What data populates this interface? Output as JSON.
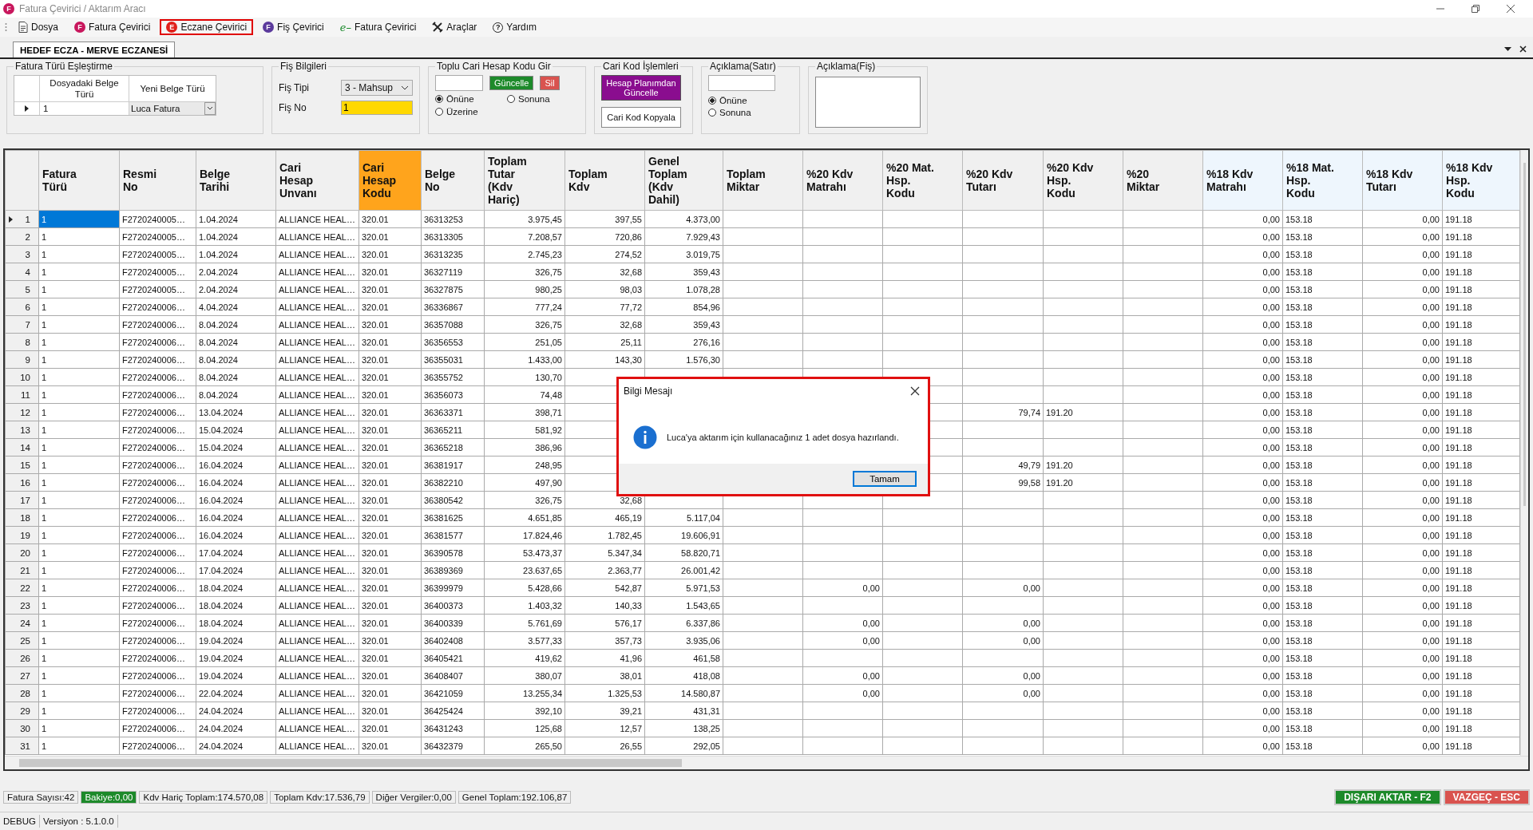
{
  "window": {
    "title": "Fatura Çevirici / Aktarım Aracı",
    "badge": "F"
  },
  "menu": [
    {
      "label": "Dosya",
      "kind": "document",
      "selected": false
    },
    {
      "label": "Fatura Çevirici",
      "kind": "badge",
      "badge": "F",
      "color": "#c8175d",
      "selected": false
    },
    {
      "label": "Eczane Çevirici",
      "kind": "badge",
      "badge": "E",
      "color": "#e0201b",
      "selected": true
    },
    {
      "label": "Fiş Çevirici",
      "kind": "badge",
      "badge": "F",
      "color": "#5b3a9c",
      "selected": false
    },
    {
      "label": "Fatura Çevirici",
      "kind": "script",
      "badge": "e–",
      "color": "#1c8a2c",
      "selected": false
    },
    {
      "label": "Araçlar",
      "kind": "tools",
      "selected": false
    },
    {
      "label": "Yardım",
      "kind": "help",
      "badge": "?",
      "selected": false
    }
  ],
  "tabs": [
    {
      "label": "HEDEF ECZA - MERVE ECZANESİ",
      "selected": true
    }
  ],
  "mapping": {
    "title": "Fatura Türü Eşleştirme",
    "columns": [
      "Dosyadaki Belge Türü",
      "Yeni Belge Türü"
    ],
    "rows": [
      {
        "source": "1",
        "target": "Luca Fatura",
        "selected": true
      }
    ]
  },
  "fis": {
    "title": "Fiş Bilgileri",
    "type_label": "Fiş Tipi",
    "type_value": "3 - Mahsup",
    "no_label": "Fiş No",
    "no_value": "1"
  },
  "bulk": {
    "title": "Toplu Cari Hesap Kodu Gir",
    "update": "Güncelle",
    "delete": "Sil",
    "options": [
      {
        "label": "Önüne",
        "selected": true
      },
      {
        "label": "Sonuna",
        "selected": false
      },
      {
        "label": "Üzerine",
        "selected": false
      }
    ]
  },
  "cari": {
    "title": "Cari Kod İşlemleri",
    "update": "Hesap Planımdan Güncelle",
    "copy": "Cari Kod Kopyala"
  },
  "desc_line": {
    "title": "Açıklama(Satır)",
    "options": [
      {
        "label": "Önüne",
        "selected": true
      },
      {
        "label": "Sonuna",
        "selected": false
      }
    ]
  },
  "desc_fis": {
    "title": "Açıklama(Fiş)"
  },
  "table": {
    "columns": [
      {
        "label": "Fatura Türü",
        "kind": "text"
      },
      {
        "label": "Resmi No",
        "kind": "text"
      },
      {
        "label": "Belge Tarihi",
        "kind": "text"
      },
      {
        "label": "Cari Hesap Unvanı",
        "kind": "text"
      },
      {
        "label": "Cari Hesap Kodu",
        "kind": "text",
        "color": "#ffa41c"
      },
      {
        "label": "Belge No",
        "kind": "text"
      },
      {
        "label": "Toplam Tutar (Kdv Hariç)",
        "kind": "number"
      },
      {
        "label": "Toplam Kdv",
        "kind": "number"
      },
      {
        "label": "Genel Toplam (Kdv Dahil)",
        "kind": "number"
      },
      {
        "label": "Toplam Miktar",
        "kind": "number"
      },
      {
        "label": "%20 Kdv Matrahı",
        "kind": "number"
      },
      {
        "label": "%20 Mat. Hsp. Kodu",
        "kind": "text"
      },
      {
        "label": "%20 Kdv Tutarı",
        "kind": "number"
      },
      {
        "label": "%20 Kdv Hsp. Kodu",
        "kind": "text"
      },
      {
        "label": "%20 Miktar",
        "kind": "number"
      },
      {
        "label": "%18 Kdv Matrahı",
        "kind": "number",
        "color": "#eef6fd"
      },
      {
        "label": "%18 Mat. Hsp. Kodu",
        "kind": "text",
        "color": "#eef6fd"
      },
      {
        "label": "%18 Kdv Tutarı",
        "kind": "number",
        "color": "#eef6fd"
      },
      {
        "label": "%18 Kdv Hsp. Kodu",
        "kind": "text",
        "color": "#eef6fd"
      }
    ],
    "rows": [
      {
        "num": "1",
        "selected": true,
        "cells": [
          "1",
          "F2720240005…",
          "1.04.2024",
          "ALLIANCE HEAL…",
          "320.01",
          "36313253",
          "3.975,45",
          "397,55",
          "4.373,00",
          null,
          null,
          null,
          null,
          null,
          null,
          "0,00",
          "153.18",
          "0,00",
          "191.18"
        ]
      },
      {
        "num": "2",
        "selected": false,
        "cells": [
          "1",
          "F2720240005…",
          "1.04.2024",
          "ALLIANCE HEAL…",
          "320.01",
          "36313305",
          "7.208,57",
          "720,86",
          "7.929,43",
          null,
          null,
          null,
          null,
          null,
          null,
          "0,00",
          "153.18",
          "0,00",
          "191.18"
        ]
      },
      {
        "num": "3",
        "selected": false,
        "cells": [
          "1",
          "F2720240005…",
          "1.04.2024",
          "ALLIANCE HEAL…",
          "320.01",
          "36313235",
          "2.745,23",
          "274,52",
          "3.019,75",
          null,
          null,
          null,
          null,
          null,
          null,
          "0,00",
          "153.18",
          "0,00",
          "191.18"
        ]
      },
      {
        "num": "4",
        "selected": false,
        "cells": [
          "1",
          "F2720240005…",
          "2.04.2024",
          "ALLIANCE HEAL…",
          "320.01",
          "36327119",
          "326,75",
          "32,68",
          "359,43",
          null,
          null,
          null,
          null,
          null,
          null,
          "0,00",
          "153.18",
          "0,00",
          "191.18"
        ]
      },
      {
        "num": "5",
        "selected": false,
        "cells": [
          "1",
          "F2720240005…",
          "2.04.2024",
          "ALLIANCE HEAL…",
          "320.01",
          "36327875",
          "980,25",
          "98,03",
          "1.078,28",
          null,
          null,
          null,
          null,
          null,
          null,
          "0,00",
          "153.18",
          "0,00",
          "191.18"
        ]
      },
      {
        "num": "6",
        "selected": false,
        "cells": [
          "1",
          "F2720240006…",
          "4.04.2024",
          "ALLIANCE HEAL…",
          "320.01",
          "36336867",
          "777,24",
          "77,72",
          "854,96",
          null,
          null,
          null,
          null,
          null,
          null,
          "0,00",
          "153.18",
          "0,00",
          "191.18"
        ]
      },
      {
        "num": "7",
        "selected": false,
        "cells": [
          "1",
          "F2720240006…",
          "8.04.2024",
          "ALLIANCE HEAL…",
          "320.01",
          "36357088",
          "326,75",
          "32,68",
          "359,43",
          null,
          null,
          null,
          null,
          null,
          null,
          "0,00",
          "153.18",
          "0,00",
          "191.18"
        ]
      },
      {
        "num": "8",
        "selected": false,
        "cells": [
          "1",
          "F2720240006…",
          "8.04.2024",
          "ALLIANCE HEAL…",
          "320.01",
          "36356553",
          "251,05",
          "25,11",
          "276,16",
          null,
          null,
          null,
          null,
          null,
          null,
          "0,00",
          "153.18",
          "0,00",
          "191.18"
        ]
      },
      {
        "num": "9",
        "selected": false,
        "cells": [
          "1",
          "F2720240006…",
          "8.04.2024",
          "ALLIANCE HEAL…",
          "320.01",
          "36355031",
          "1.433,00",
          "143,30",
          "1.576,30",
          null,
          null,
          null,
          null,
          null,
          null,
          "0,00",
          "153.18",
          "0,00",
          "191.18"
        ]
      },
      {
        "num": "10",
        "selected": false,
        "cells": [
          "1",
          "F2720240006…",
          "8.04.2024",
          "ALLIANCE HEAL…",
          "320.01",
          "36355752",
          "130,70",
          null,
          null,
          null,
          null,
          null,
          null,
          null,
          null,
          "0,00",
          "153.18",
          "0,00",
          "191.18"
        ]
      },
      {
        "num": "11",
        "selected": false,
        "cells": [
          "1",
          "F2720240006…",
          "8.04.2024",
          "ALLIANCE HEAL…",
          "320.01",
          "36356073",
          "74,48",
          null,
          null,
          null,
          null,
          null,
          null,
          null,
          null,
          "0,00",
          "153.18",
          "0,00",
          "191.18"
        ]
      },
      {
        "num": "12",
        "selected": false,
        "cells": [
          "1",
          "F2720240006…",
          "13.04.2024",
          "ALLIANCE HEAL…",
          "320.01",
          "36363371",
          "398,71",
          null,
          null,
          null,
          null,
          null,
          "79,74",
          "191.20",
          null,
          "0,00",
          "153.18",
          "0,00",
          "191.18"
        ]
      },
      {
        "num": "13",
        "selected": false,
        "cells": [
          "1",
          "F2720240006…",
          "15.04.2024",
          "ALLIANCE HEAL…",
          "320.01",
          "36365211",
          "581,92",
          null,
          null,
          null,
          null,
          null,
          null,
          null,
          null,
          "0,00",
          "153.18",
          "0,00",
          "191.18"
        ]
      },
      {
        "num": "14",
        "selected": false,
        "cells": [
          "1",
          "F2720240006…",
          "15.04.2024",
          "ALLIANCE HEAL…",
          "320.01",
          "36365218",
          "386,96",
          null,
          null,
          null,
          null,
          null,
          null,
          null,
          null,
          "0,00",
          "153.18",
          "0,00",
          "191.18"
        ]
      },
      {
        "num": "15",
        "selected": false,
        "cells": [
          "1",
          "F2720240006…",
          "16.04.2024",
          "ALLIANCE HEAL…",
          "320.01",
          "36381917",
          "248,95",
          null,
          null,
          null,
          null,
          null,
          "49,79",
          "191.20",
          null,
          "0,00",
          "153.18",
          "0,00",
          "191.18"
        ]
      },
      {
        "num": "16",
        "selected": false,
        "cells": [
          "1",
          "F2720240006…",
          "16.04.2024",
          "ALLIANCE HEAL…",
          "320.01",
          "36382210",
          "497,90",
          null,
          null,
          null,
          null,
          null,
          "99,58",
          "191.20",
          null,
          "0,00",
          "153.18",
          "0,00",
          "191.18"
        ]
      },
      {
        "num": "17",
        "selected": false,
        "cells": [
          "1",
          "F2720240006…",
          "16.04.2024",
          "ALLIANCE HEAL…",
          "320.01",
          "36380542",
          "326,75",
          "32,68",
          null,
          null,
          null,
          null,
          null,
          null,
          null,
          "0,00",
          "153.18",
          "0,00",
          "191.18"
        ]
      },
      {
        "num": "18",
        "selected": false,
        "cells": [
          "1",
          "F2720240006…",
          "16.04.2024",
          "ALLIANCE HEAL…",
          "320.01",
          "36381625",
          "4.651,85",
          "465,19",
          "5.117,04",
          null,
          null,
          null,
          null,
          null,
          null,
          "0,00",
          "153.18",
          "0,00",
          "191.18"
        ]
      },
      {
        "num": "19",
        "selected": false,
        "cells": [
          "1",
          "F2720240006…",
          "16.04.2024",
          "ALLIANCE HEAL…",
          "320.01",
          "36381577",
          "17.824,46",
          "1.782,45",
          "19.606,91",
          null,
          null,
          null,
          null,
          null,
          null,
          "0,00",
          "153.18",
          "0,00",
          "191.18"
        ]
      },
      {
        "num": "20",
        "selected": false,
        "cells": [
          "1",
          "F2720240006…",
          "17.04.2024",
          "ALLIANCE HEAL…",
          "320.01",
          "36390578",
          "53.473,37",
          "5.347,34",
          "58.820,71",
          null,
          null,
          null,
          null,
          null,
          null,
          "0,00",
          "153.18",
          "0,00",
          "191.18"
        ]
      },
      {
        "num": "21",
        "selected": false,
        "cells": [
          "1",
          "F2720240006…",
          "17.04.2024",
          "ALLIANCE HEAL…",
          "320.01",
          "36389369",
          "23.637,65",
          "2.363,77",
          "26.001,42",
          null,
          null,
          null,
          null,
          null,
          null,
          "0,00",
          "153.18",
          "0,00",
          "191.18"
        ]
      },
      {
        "num": "22",
        "selected": false,
        "cells": [
          "1",
          "F2720240006…",
          "18.04.2024",
          "ALLIANCE HEAL…",
          "320.01",
          "36399979",
          "5.428,66",
          "542,87",
          "5.971,53",
          null,
          "0,00",
          null,
          "0,00",
          null,
          null,
          "0,00",
          "153.18",
          "0,00",
          "191.18"
        ]
      },
      {
        "num": "23",
        "selected": false,
        "cells": [
          "1",
          "F2720240006…",
          "18.04.2024",
          "ALLIANCE HEAL…",
          "320.01",
          "36400373",
          "1.403,32",
          "140,33",
          "1.543,65",
          null,
          null,
          null,
          null,
          null,
          null,
          "0,00",
          "153.18",
          "0,00",
          "191.18"
        ]
      },
      {
        "num": "24",
        "selected": false,
        "cells": [
          "1",
          "F2720240006…",
          "18.04.2024",
          "ALLIANCE HEAL…",
          "320.01",
          "36400339",
          "5.761,69",
          "576,17",
          "6.337,86",
          null,
          "0,00",
          null,
          "0,00",
          null,
          null,
          "0,00",
          "153.18",
          "0,00",
          "191.18"
        ]
      },
      {
        "num": "25",
        "selected": false,
        "cells": [
          "1",
          "F2720240006…",
          "19.04.2024",
          "ALLIANCE HEAL…",
          "320.01",
          "36402408",
          "3.577,33",
          "357,73",
          "3.935,06",
          null,
          "0,00",
          null,
          "0,00",
          null,
          null,
          "0,00",
          "153.18",
          "0,00",
          "191.18"
        ]
      },
      {
        "num": "26",
        "selected": false,
        "cells": [
          "1",
          "F2720240006…",
          "19.04.2024",
          "ALLIANCE HEAL…",
          "320.01",
          "36405421",
          "419,62",
          "41,96",
          "461,58",
          null,
          null,
          null,
          null,
          null,
          null,
          "0,00",
          "153.18",
          "0,00",
          "191.18"
        ]
      },
      {
        "num": "27",
        "selected": false,
        "cells": [
          "1",
          "F2720240006…",
          "19.04.2024",
          "ALLIANCE HEAL…",
          "320.01",
          "36408407",
          "380,07",
          "38,01",
          "418,08",
          null,
          "0,00",
          null,
          "0,00",
          null,
          null,
          "0,00",
          "153.18",
          "0,00",
          "191.18"
        ]
      },
      {
        "num": "28",
        "selected": false,
        "cells": [
          "1",
          "F2720240006…",
          "22.04.2024",
          "ALLIANCE HEAL…",
          "320.01",
          "36421059",
          "13.255,34",
          "1.325,53",
          "14.580,87",
          null,
          "0,00",
          null,
          "0,00",
          null,
          null,
          "0,00",
          "153.18",
          "0,00",
          "191.18"
        ]
      },
      {
        "num": "29",
        "selected": false,
        "cells": [
          "1",
          "F2720240006…",
          "24.04.2024",
          "ALLIANCE HEAL…",
          "320.01",
          "36425424",
          "392,10",
          "39,21",
          "431,31",
          null,
          null,
          null,
          null,
          null,
          null,
          "0,00",
          "153.18",
          "0,00",
          "191.18"
        ]
      },
      {
        "num": "30",
        "selected": false,
        "cells": [
          "1",
          "F2720240006…",
          "24.04.2024",
          "ALLIANCE HEAL…",
          "320.01",
          "36431243",
          "125,68",
          "12,57",
          "138,25",
          null,
          null,
          null,
          null,
          null,
          null,
          "0,00",
          "153.18",
          "0,00",
          "191.18"
        ]
      },
      {
        "num": "31",
        "selected": false,
        "cells": [
          "1",
          "F2720240006…",
          "24.04.2024",
          "ALLIANCE HEAL…",
          "320.01",
          "36432379",
          "265,50",
          "26,55",
          "292,05",
          null,
          null,
          null,
          null,
          null,
          null,
          "0,00",
          "153.18",
          "0,00",
          "191.18"
        ]
      }
    ]
  },
  "dialog": {
    "title": "Bilgi Mesajı",
    "message": "Luca'ya aktarım için kullanacağınız 1 adet dosya hazırlandı.",
    "button": "Tamam"
  },
  "status_bar": {
    "items": [
      {
        "text": "Fatura Sayısı:42",
        "highlight": false
      },
      {
        "text": "Bakiye:0,00",
        "highlight": true
      },
      {
        "text": "Kdv Hariç Toplam:174.570,08",
        "highlight": false
      },
      {
        "text": "Toplam Kdv:17.536,79",
        "highlight": false
      },
      {
        "text": "Diğer Vergiler:0,00",
        "highlight": false
      },
      {
        "text": "Genel Toplam:192.106,87",
        "highlight": false
      }
    ],
    "export": "DIŞARI AKTAR - F2",
    "cancel": "VAZGEÇ - ESC"
  },
  "footer": [
    "DEBUG",
    "Versiyon : 5.1.0.0"
  ]
}
